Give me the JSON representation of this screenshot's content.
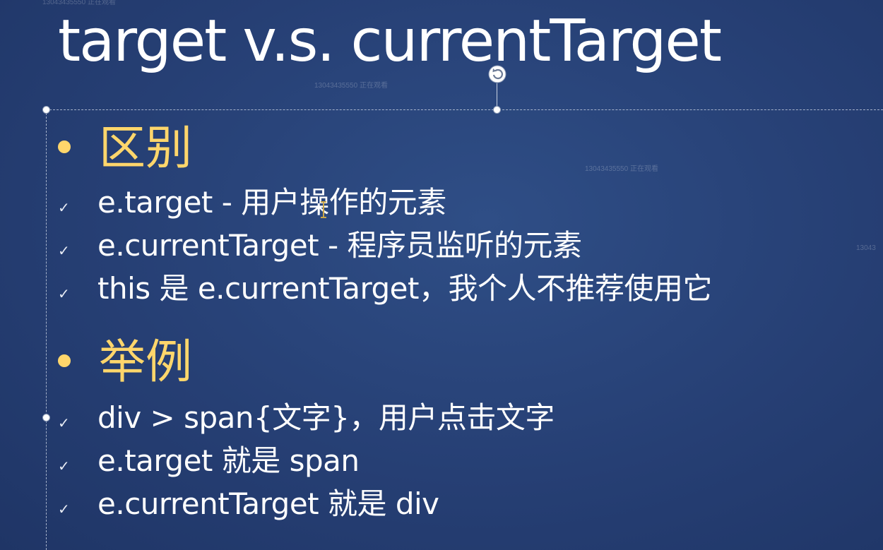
{
  "watermark": "13043435550 正在观看",
  "watermark_partial": "13043",
  "slide": {
    "title": "target v.s. currentTarget",
    "sections": [
      {
        "heading": "区别",
        "items": [
          "e.target - 用户操作的元素",
          "e.currentTarget - 程序员监听的元素",
          "this 是 e.currentTarget，我个人不推荐使用它"
        ]
      },
      {
        "heading": "举例",
        "items": [
          "div > span{文字}，用户点击文字",
          "e.target 就是 span",
          "e.currentTarget 就是 div"
        ]
      }
    ]
  },
  "colors": {
    "background": "#2a4579",
    "heading": "#ffd66b",
    "text": "#ffffff"
  },
  "icons": {
    "rotate": "rotate-handle-icon",
    "check": "checkmark-icon",
    "cursor": "text-cursor-icon"
  }
}
